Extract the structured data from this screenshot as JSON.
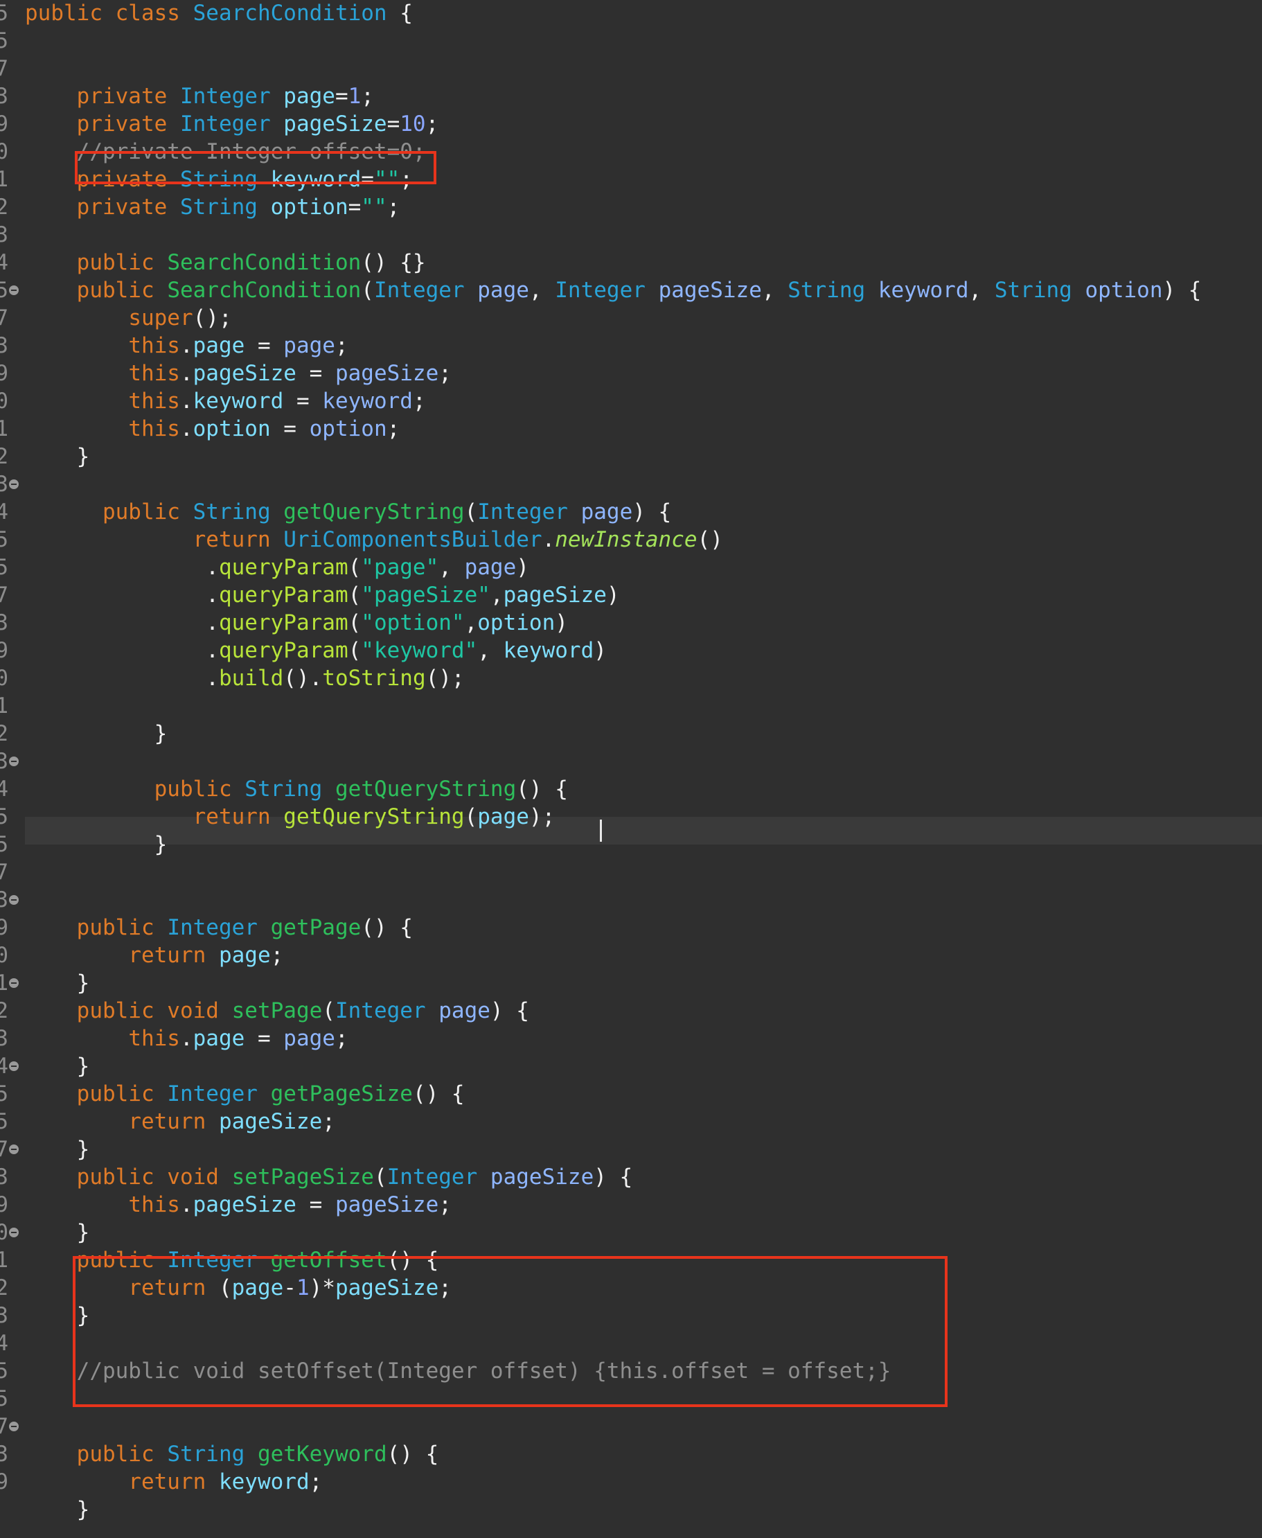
{
  "editor": {
    "language": "Java",
    "current_line": "return getQueryString(page);",
    "highlight_color": "#e8341c",
    "gutter": [
      {
        "num": "5",
        "fold": false
      },
      {
        "num": "5",
        "fold": false
      },
      {
        "num": "7",
        "fold": false
      },
      {
        "num": "3",
        "fold": false
      },
      {
        "num": "9",
        "fold": false
      },
      {
        "num": "0",
        "fold": false
      },
      {
        "num": "1",
        "fold": false
      },
      {
        "num": "2",
        "fold": false
      },
      {
        "num": "3",
        "fold": false
      },
      {
        "num": "4",
        "fold": false
      },
      {
        "num": "5",
        "fold": true
      },
      {
        "num": "7",
        "fold": false
      },
      {
        "num": "3",
        "fold": false
      },
      {
        "num": "9",
        "fold": false
      },
      {
        "num": "0",
        "fold": false
      },
      {
        "num": "1",
        "fold": false
      },
      {
        "num": "2",
        "fold": false
      },
      {
        "num": "3",
        "fold": true
      },
      {
        "num": "4",
        "fold": false
      },
      {
        "num": "5",
        "fold": false
      },
      {
        "num": "5",
        "fold": false
      },
      {
        "num": "7",
        "fold": false
      },
      {
        "num": "3",
        "fold": false
      },
      {
        "num": "9",
        "fold": false
      },
      {
        "num": "0",
        "fold": false
      },
      {
        "num": "1",
        "fold": false
      },
      {
        "num": "2",
        "fold": false
      },
      {
        "num": "3",
        "fold": true
      },
      {
        "num": "4",
        "fold": false
      },
      {
        "num": "5",
        "fold": false
      },
      {
        "num": "5",
        "fold": false
      },
      {
        "num": "7",
        "fold": false
      },
      {
        "num": "3",
        "fold": true
      },
      {
        "num": "9",
        "fold": false
      },
      {
        "num": "0",
        "fold": false
      },
      {
        "num": "1",
        "fold": true
      },
      {
        "num": "2",
        "fold": false
      },
      {
        "num": "3",
        "fold": false
      },
      {
        "num": "4",
        "fold": true
      },
      {
        "num": "5",
        "fold": false
      },
      {
        "num": "5",
        "fold": false
      },
      {
        "num": "7",
        "fold": true
      },
      {
        "num": "3",
        "fold": false
      },
      {
        "num": "9",
        "fold": false
      },
      {
        "num": "0",
        "fold": true
      },
      {
        "num": "1",
        "fold": false
      },
      {
        "num": "2",
        "fold": false
      },
      {
        "num": "3",
        "fold": false
      },
      {
        "num": "4",
        "fold": false
      },
      {
        "num": "5",
        "fold": false
      },
      {
        "num": "5",
        "fold": false
      },
      {
        "num": "7",
        "fold": true
      },
      {
        "num": "3",
        "fold": false
      },
      {
        "num": "9",
        "fold": false
      }
    ],
    "lines": [
      [
        [
          "kw",
          "public class "
        ],
        [
          "ty",
          "SearchCondition"
        ],
        [
          "pl",
          " {"
        ]
      ],
      [],
      [],
      [
        [
          "pl",
          "    "
        ],
        [
          "kw",
          "private "
        ],
        [
          "ty",
          "Integer "
        ],
        [
          "fd",
          "page"
        ],
        [
          "pl",
          "="
        ],
        [
          "nm",
          "1"
        ],
        [
          "pl",
          ";"
        ]
      ],
      [
        [
          "pl",
          "    "
        ],
        [
          "kw",
          "private "
        ],
        [
          "ty",
          "Integer "
        ],
        [
          "fd",
          "pageSize"
        ],
        [
          "pl",
          "="
        ],
        [
          "nm",
          "10"
        ],
        [
          "pl",
          ";"
        ]
      ],
      [
        [
          "pl",
          "    "
        ],
        [
          "cm",
          "//private Integer offset=0;"
        ]
      ],
      [
        [
          "pl",
          "    "
        ],
        [
          "kw",
          "private "
        ],
        [
          "ty",
          "String "
        ],
        [
          "fd",
          "keyword"
        ],
        [
          "pl",
          "="
        ],
        [
          "st",
          "\"\""
        ],
        [
          "pl",
          ";"
        ]
      ],
      [
        [
          "pl",
          "    "
        ],
        [
          "kw",
          "private "
        ],
        [
          "ty",
          "String "
        ],
        [
          "fd",
          "option"
        ],
        [
          "pl",
          "="
        ],
        [
          "st",
          "\"\""
        ],
        [
          "pl",
          ";"
        ]
      ],
      [],
      [
        [
          "pl",
          "    "
        ],
        [
          "kw",
          "public "
        ],
        [
          "mt",
          "SearchCondition"
        ],
        [
          "pl",
          "() {}"
        ]
      ],
      [
        [
          "pl",
          "    "
        ],
        [
          "kw",
          "public "
        ],
        [
          "mt",
          "SearchCondition"
        ],
        [
          "pl",
          "("
        ],
        [
          "ty",
          "Integer "
        ],
        [
          "pr",
          "page"
        ],
        [
          "pl",
          ", "
        ],
        [
          "ty",
          "Integer "
        ],
        [
          "pr",
          "pageSize"
        ],
        [
          "pl",
          ", "
        ],
        [
          "ty",
          "String "
        ],
        [
          "pr",
          "keyword"
        ],
        [
          "pl",
          ", "
        ],
        [
          "ty",
          "String "
        ],
        [
          "pr",
          "option"
        ],
        [
          "pl",
          ") {"
        ]
      ],
      [
        [
          "pl",
          "        "
        ],
        [
          "kw",
          "super"
        ],
        [
          "pl",
          "();"
        ]
      ],
      [
        [
          "pl",
          "        "
        ],
        [
          "kw",
          "this"
        ],
        [
          "pl",
          "."
        ],
        [
          "fd",
          "page"
        ],
        [
          "pl",
          " = "
        ],
        [
          "pr",
          "page"
        ],
        [
          "pl",
          ";"
        ]
      ],
      [
        [
          "pl",
          "        "
        ],
        [
          "kw",
          "this"
        ],
        [
          "pl",
          "."
        ],
        [
          "fd",
          "pageSize"
        ],
        [
          "pl",
          " = "
        ],
        [
          "pr",
          "pageSize"
        ],
        [
          "pl",
          ";"
        ]
      ],
      [
        [
          "pl",
          "        "
        ],
        [
          "kw",
          "this"
        ],
        [
          "pl",
          "."
        ],
        [
          "fd",
          "keyword"
        ],
        [
          "pl",
          " = "
        ],
        [
          "pr",
          "keyword"
        ],
        [
          "pl",
          ";"
        ]
      ],
      [
        [
          "pl",
          "        "
        ],
        [
          "kw",
          "this"
        ],
        [
          "pl",
          "."
        ],
        [
          "fd",
          "option"
        ],
        [
          "pl",
          " = "
        ],
        [
          "pr",
          "option"
        ],
        [
          "pl",
          ";"
        ]
      ],
      [
        [
          "pl",
          "    }"
        ]
      ],
      [],
      [
        [
          "pl",
          "      "
        ],
        [
          "kw",
          "public "
        ],
        [
          "ty",
          "String "
        ],
        [
          "mt",
          "getQueryString"
        ],
        [
          "pl",
          "("
        ],
        [
          "ty",
          "Integer "
        ],
        [
          "pr",
          "page"
        ],
        [
          "pl",
          ") {"
        ]
      ],
      [
        [
          "pl",
          "             "
        ],
        [
          "kw",
          "return "
        ],
        [
          "ty",
          "UriComponentsBuilder"
        ],
        [
          "pl",
          "."
        ],
        [
          "sc",
          "newInstance"
        ],
        [
          "pl",
          "()"
        ]
      ],
      [
        [
          "pl",
          "              ."
        ],
        [
          "cl",
          "queryParam"
        ],
        [
          "pl",
          "("
        ],
        [
          "st",
          "\"page\""
        ],
        [
          "pl",
          ", "
        ],
        [
          "pr",
          "page"
        ],
        [
          "pl",
          ")"
        ]
      ],
      [
        [
          "pl",
          "              ."
        ],
        [
          "cl",
          "queryParam"
        ],
        [
          "pl",
          "("
        ],
        [
          "st",
          "\"pageSize\""
        ],
        [
          "pl",
          ","
        ],
        [
          "fd",
          "pageSize"
        ],
        [
          "pl",
          ")"
        ]
      ],
      [
        [
          "pl",
          "              ."
        ],
        [
          "cl",
          "queryParam"
        ],
        [
          "pl",
          "("
        ],
        [
          "st",
          "\"option\""
        ],
        [
          "pl",
          ","
        ],
        [
          "fd",
          "option"
        ],
        [
          "pl",
          ")"
        ]
      ],
      [
        [
          "pl",
          "              ."
        ],
        [
          "cl",
          "queryParam"
        ],
        [
          "pl",
          "("
        ],
        [
          "st",
          "\"keyword\""
        ],
        [
          "pl",
          ", "
        ],
        [
          "fd",
          "keyword"
        ],
        [
          "pl",
          ")"
        ]
      ],
      [
        [
          "pl",
          "              ."
        ],
        [
          "cl",
          "build"
        ],
        [
          "pl",
          "()."
        ],
        [
          "cl",
          "toString"
        ],
        [
          "pl",
          "();"
        ]
      ],
      [],
      [
        [
          "pl",
          "          }"
        ]
      ],
      [],
      [
        [
          "pl",
          "          "
        ],
        [
          "kw",
          "public "
        ],
        [
          "ty",
          "String "
        ],
        [
          "mt",
          "getQueryString"
        ],
        [
          "pl",
          "() {"
        ]
      ],
      [
        [
          "pl",
          "             "
        ],
        [
          "kw",
          "return "
        ],
        [
          "cl",
          "getQueryString"
        ],
        [
          "pl",
          "("
        ],
        [
          "fd",
          "page"
        ],
        [
          "pl",
          ");"
        ]
      ],
      [
        [
          "pl",
          "          }"
        ]
      ],
      [],
      [],
      [
        [
          "pl",
          "    "
        ],
        [
          "kw",
          "public "
        ],
        [
          "ty",
          "Integer "
        ],
        [
          "mt",
          "getPage"
        ],
        [
          "pl",
          "() {"
        ]
      ],
      [
        [
          "pl",
          "        "
        ],
        [
          "kw",
          "return "
        ],
        [
          "fd",
          "page"
        ],
        [
          "pl",
          ";"
        ]
      ],
      [
        [
          "pl",
          "    }"
        ]
      ],
      [
        [
          "pl",
          "    "
        ],
        [
          "kw",
          "public void "
        ],
        [
          "mt",
          "setPage"
        ],
        [
          "pl",
          "("
        ],
        [
          "ty",
          "Integer "
        ],
        [
          "pr",
          "page"
        ],
        [
          "pl",
          ") {"
        ]
      ],
      [
        [
          "pl",
          "        "
        ],
        [
          "kw",
          "this"
        ],
        [
          "pl",
          "."
        ],
        [
          "fd",
          "page"
        ],
        [
          "pl",
          " = "
        ],
        [
          "pr",
          "page"
        ],
        [
          "pl",
          ";"
        ]
      ],
      [
        [
          "pl",
          "    }"
        ]
      ],
      [
        [
          "pl",
          "    "
        ],
        [
          "kw",
          "public "
        ],
        [
          "ty",
          "Integer "
        ],
        [
          "mt",
          "getPageSize"
        ],
        [
          "pl",
          "() {"
        ]
      ],
      [
        [
          "pl",
          "        "
        ],
        [
          "kw",
          "return "
        ],
        [
          "fd",
          "pageSize"
        ],
        [
          "pl",
          ";"
        ]
      ],
      [
        [
          "pl",
          "    }"
        ]
      ],
      [
        [
          "pl",
          "    "
        ],
        [
          "kw",
          "public void "
        ],
        [
          "mt",
          "setPageSize"
        ],
        [
          "pl",
          "("
        ],
        [
          "ty",
          "Integer "
        ],
        [
          "pr",
          "pageSize"
        ],
        [
          "pl",
          ") {"
        ]
      ],
      [
        [
          "pl",
          "        "
        ],
        [
          "kw",
          "this"
        ],
        [
          "pl",
          "."
        ],
        [
          "fd",
          "pageSize"
        ],
        [
          "pl",
          " = "
        ],
        [
          "pr",
          "pageSize"
        ],
        [
          "pl",
          ";"
        ]
      ],
      [
        [
          "pl",
          "    }"
        ]
      ],
      [
        [
          "pl",
          "    "
        ],
        [
          "kw",
          "public "
        ],
        [
          "ty",
          "Integer "
        ],
        [
          "mt",
          "getOffset"
        ],
        [
          "pl",
          "() {"
        ]
      ],
      [
        [
          "pl",
          "        "
        ],
        [
          "kw",
          "return "
        ],
        [
          "pl",
          "("
        ],
        [
          "fd",
          "page"
        ],
        [
          "pl",
          "-"
        ],
        [
          "nm",
          "1"
        ],
        [
          "pl",
          ")*"
        ],
        [
          "fd",
          "pageSize"
        ],
        [
          "pl",
          ";"
        ]
      ],
      [
        [
          "pl",
          "    }"
        ]
      ],
      [],
      [
        [
          "pl",
          "    "
        ],
        [
          "cm",
          "//public void setOffset(Integer offset) {this.offset = offset;}"
        ]
      ],
      [],
      [],
      [
        [
          "pl",
          "    "
        ],
        [
          "kw",
          "public "
        ],
        [
          "ty",
          "String "
        ],
        [
          "mt",
          "getKeyword"
        ],
        [
          "pl",
          "() {"
        ]
      ],
      [
        [
          "pl",
          "        "
        ],
        [
          "kw",
          "return "
        ],
        [
          "fd",
          "keyword"
        ],
        [
          "pl",
          ";"
        ]
      ],
      [
        [
          "pl",
          "    }"
        ]
      ]
    ]
  }
}
